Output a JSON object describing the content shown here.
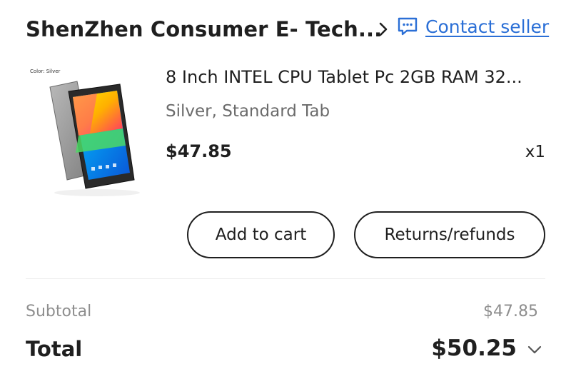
{
  "store": {
    "name": "ShenZhen Consumer E- Tech...",
    "contact_label": "Contact seller"
  },
  "product": {
    "image_caption": "Color: Silver",
    "title": "8 Inch INTEL CPU Tablet Pc 2GB RAM 32...",
    "variant": "Silver, Standard Tab",
    "price": "$47.85",
    "quantity": "x1"
  },
  "actions": {
    "add_to_cart": "Add to cart",
    "returns": "Returns/refunds"
  },
  "summary": {
    "subtotal_label": "Subtotal",
    "subtotal_value": "$47.85",
    "total_label": "Total",
    "total_value": "$50.25"
  },
  "icons": {
    "store_chevron": "chevron-right-icon",
    "contact": "chat-icon",
    "total_expand": "chevron-down-icon"
  },
  "colors": {
    "link": "#2b6fd6",
    "text": "#1f1f1f",
    "muted": "#8e8e8e"
  }
}
